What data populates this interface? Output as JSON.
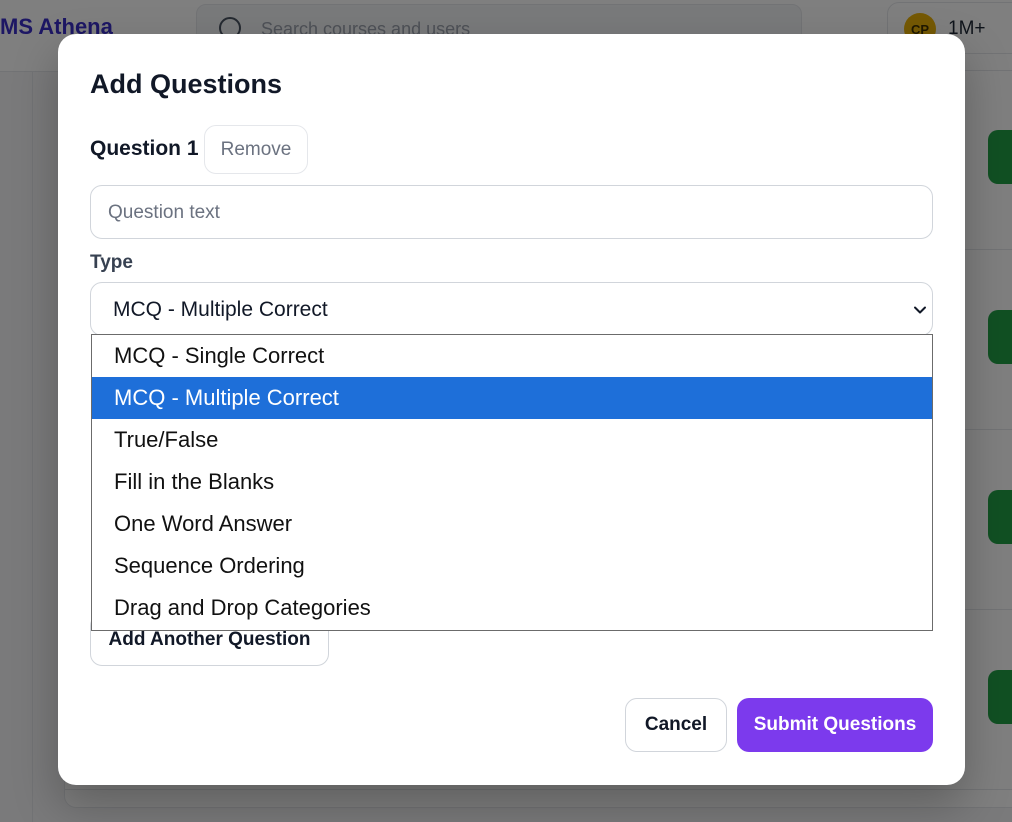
{
  "app": {
    "brand": "MS Athena",
    "search_placeholder": "Search courses and users",
    "user": {
      "initials": "CP",
      "count": "1M+"
    }
  },
  "modal": {
    "title": "Add Questions",
    "question_label": "Question 1",
    "remove_label": "Remove",
    "question_placeholder": "Question text",
    "type_label": "Type",
    "type_selected": "MCQ - Multiple Correct",
    "type_options": [
      "MCQ - Single Correct",
      "MCQ - Multiple Correct",
      "True/False",
      "Fill in the Blanks",
      "One Word Answer",
      "Sequence Ordering",
      "Drag and Drop Categories"
    ],
    "add_another_label": "Add Another Question",
    "cancel_label": "Cancel",
    "submit_label": "Submit Questions"
  },
  "colors": {
    "brand": "#3b2fc9",
    "primary": "#7c3aed",
    "option_highlight": "#1e6fd9",
    "success": "#22a046"
  }
}
